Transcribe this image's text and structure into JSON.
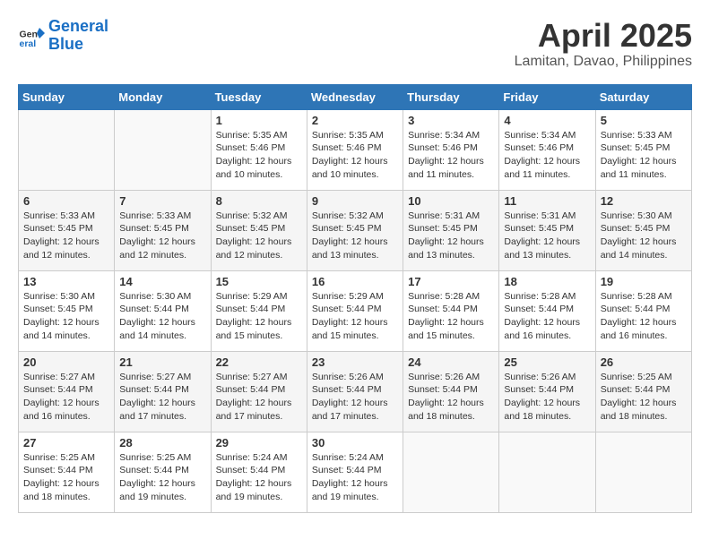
{
  "header": {
    "logo_line1": "General",
    "logo_line2": "Blue",
    "month": "April 2025",
    "location": "Lamitan, Davao, Philippines"
  },
  "weekdays": [
    "Sunday",
    "Monday",
    "Tuesday",
    "Wednesday",
    "Thursday",
    "Friday",
    "Saturday"
  ],
  "weeks": [
    [
      {
        "day": "",
        "info": ""
      },
      {
        "day": "",
        "info": ""
      },
      {
        "day": "1",
        "sunrise": "5:35 AM",
        "sunset": "5:46 PM",
        "daylight": "12 hours and 10 minutes."
      },
      {
        "day": "2",
        "sunrise": "5:35 AM",
        "sunset": "5:46 PM",
        "daylight": "12 hours and 10 minutes."
      },
      {
        "day": "3",
        "sunrise": "5:34 AM",
        "sunset": "5:46 PM",
        "daylight": "12 hours and 11 minutes."
      },
      {
        "day": "4",
        "sunrise": "5:34 AM",
        "sunset": "5:46 PM",
        "daylight": "12 hours and 11 minutes."
      },
      {
        "day": "5",
        "sunrise": "5:33 AM",
        "sunset": "5:45 PM",
        "daylight": "12 hours and 11 minutes."
      }
    ],
    [
      {
        "day": "6",
        "sunrise": "5:33 AM",
        "sunset": "5:45 PM",
        "daylight": "12 hours and 12 minutes."
      },
      {
        "day": "7",
        "sunrise": "5:33 AM",
        "sunset": "5:45 PM",
        "daylight": "12 hours and 12 minutes."
      },
      {
        "day": "8",
        "sunrise": "5:32 AM",
        "sunset": "5:45 PM",
        "daylight": "12 hours and 12 minutes."
      },
      {
        "day": "9",
        "sunrise": "5:32 AM",
        "sunset": "5:45 PM",
        "daylight": "12 hours and 13 minutes."
      },
      {
        "day": "10",
        "sunrise": "5:31 AM",
        "sunset": "5:45 PM",
        "daylight": "12 hours and 13 minutes."
      },
      {
        "day": "11",
        "sunrise": "5:31 AM",
        "sunset": "5:45 PM",
        "daylight": "12 hours and 13 minutes."
      },
      {
        "day": "12",
        "sunrise": "5:30 AM",
        "sunset": "5:45 PM",
        "daylight": "12 hours and 14 minutes."
      }
    ],
    [
      {
        "day": "13",
        "sunrise": "5:30 AM",
        "sunset": "5:45 PM",
        "daylight": "12 hours and 14 minutes."
      },
      {
        "day": "14",
        "sunrise": "5:30 AM",
        "sunset": "5:44 PM",
        "daylight": "12 hours and 14 minutes."
      },
      {
        "day": "15",
        "sunrise": "5:29 AM",
        "sunset": "5:44 PM",
        "daylight": "12 hours and 15 minutes."
      },
      {
        "day": "16",
        "sunrise": "5:29 AM",
        "sunset": "5:44 PM",
        "daylight": "12 hours and 15 minutes."
      },
      {
        "day": "17",
        "sunrise": "5:28 AM",
        "sunset": "5:44 PM",
        "daylight": "12 hours and 15 minutes."
      },
      {
        "day": "18",
        "sunrise": "5:28 AM",
        "sunset": "5:44 PM",
        "daylight": "12 hours and 16 minutes."
      },
      {
        "day": "19",
        "sunrise": "5:28 AM",
        "sunset": "5:44 PM",
        "daylight": "12 hours and 16 minutes."
      }
    ],
    [
      {
        "day": "20",
        "sunrise": "5:27 AM",
        "sunset": "5:44 PM",
        "daylight": "12 hours and 16 minutes."
      },
      {
        "day": "21",
        "sunrise": "5:27 AM",
        "sunset": "5:44 PM",
        "daylight": "12 hours and 17 minutes."
      },
      {
        "day": "22",
        "sunrise": "5:27 AM",
        "sunset": "5:44 PM",
        "daylight": "12 hours and 17 minutes."
      },
      {
        "day": "23",
        "sunrise": "5:26 AM",
        "sunset": "5:44 PM",
        "daylight": "12 hours and 17 minutes."
      },
      {
        "day": "24",
        "sunrise": "5:26 AM",
        "sunset": "5:44 PM",
        "daylight": "12 hours and 18 minutes."
      },
      {
        "day": "25",
        "sunrise": "5:26 AM",
        "sunset": "5:44 PM",
        "daylight": "12 hours and 18 minutes."
      },
      {
        "day": "26",
        "sunrise": "5:25 AM",
        "sunset": "5:44 PM",
        "daylight": "12 hours and 18 minutes."
      }
    ],
    [
      {
        "day": "27",
        "sunrise": "5:25 AM",
        "sunset": "5:44 PM",
        "daylight": "12 hours and 18 minutes."
      },
      {
        "day": "28",
        "sunrise": "5:25 AM",
        "sunset": "5:44 PM",
        "daylight": "12 hours and 19 minutes."
      },
      {
        "day": "29",
        "sunrise": "5:24 AM",
        "sunset": "5:44 PM",
        "daylight": "12 hours and 19 minutes."
      },
      {
        "day": "30",
        "sunrise": "5:24 AM",
        "sunset": "5:44 PM",
        "daylight": "12 hours and 19 minutes."
      },
      {
        "day": "",
        "info": ""
      },
      {
        "day": "",
        "info": ""
      },
      {
        "day": "",
        "info": ""
      }
    ]
  ]
}
